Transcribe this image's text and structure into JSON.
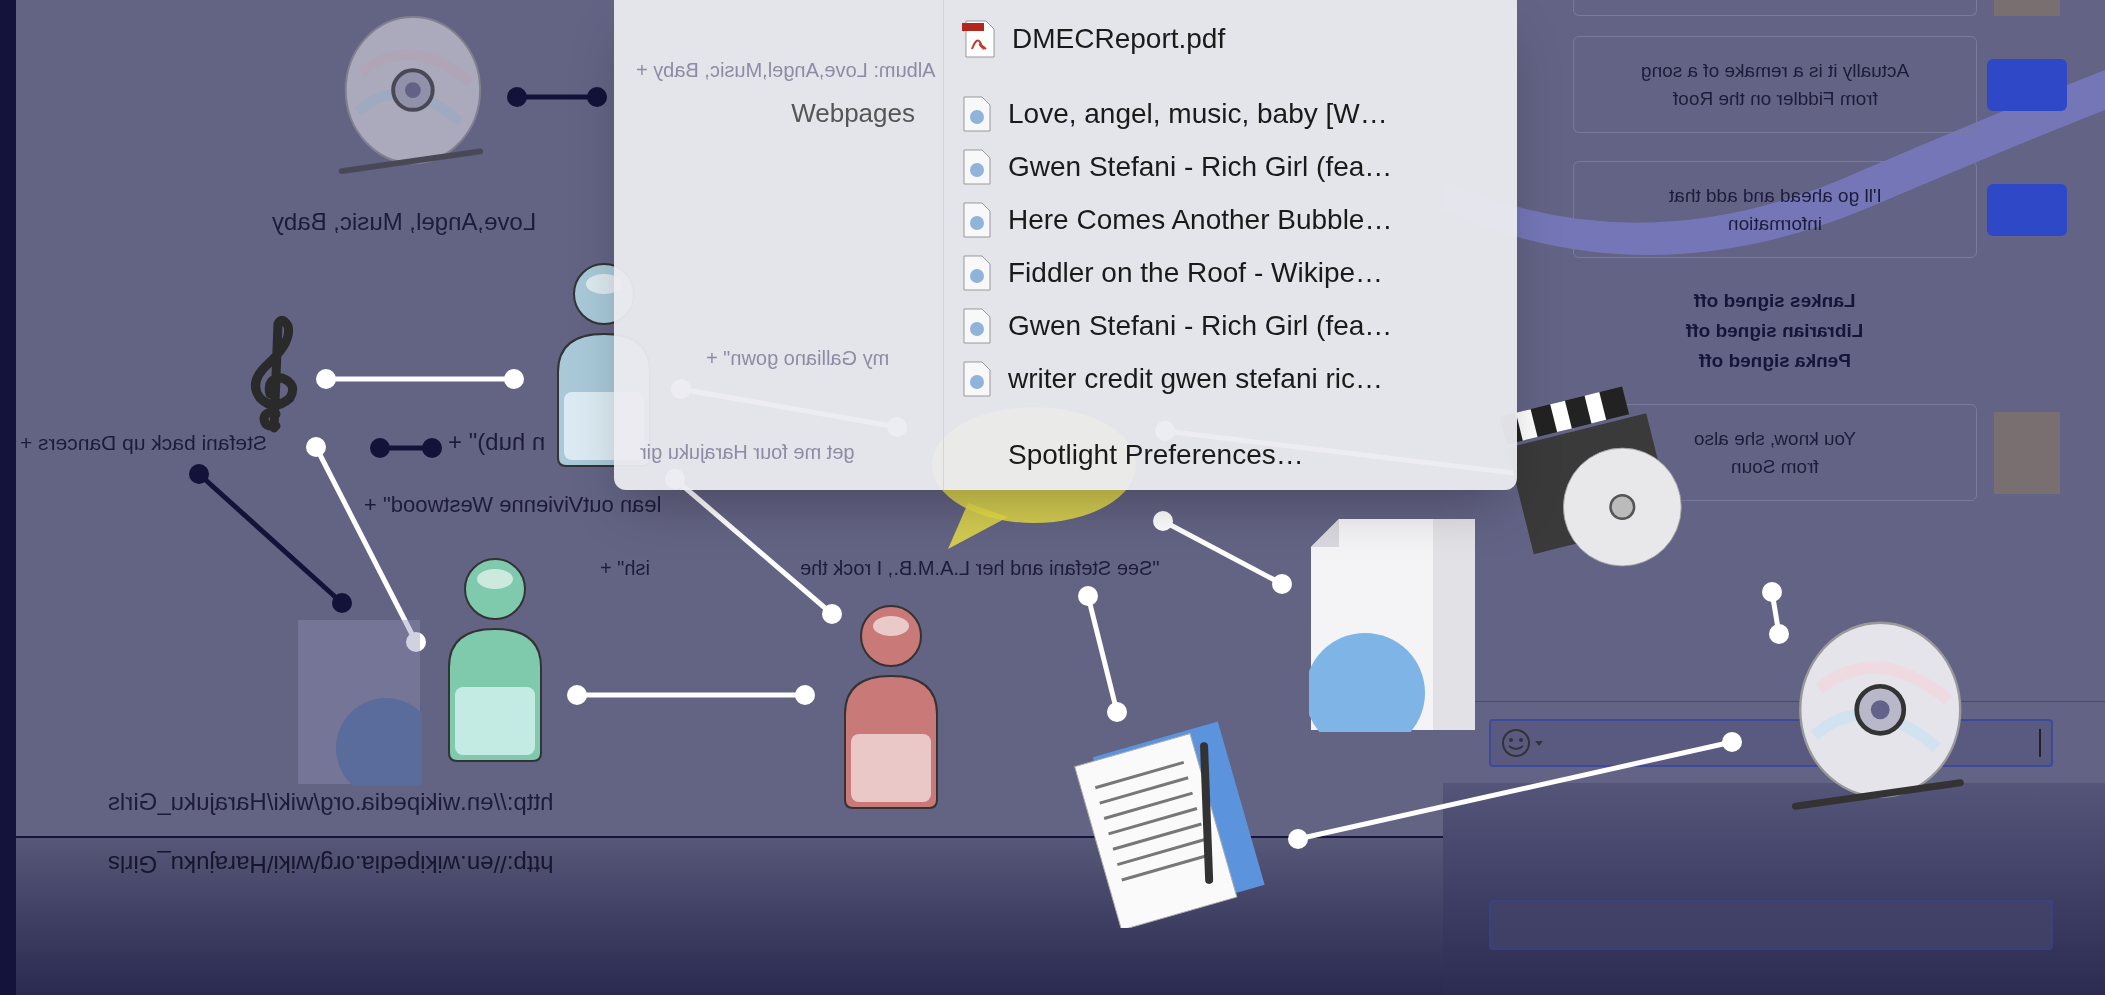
{
  "canvas": {
    "labels": [
      {
        "kind": "ghost",
        "text": "Album: Love,Angel,Music, Baby +"
      },
      {
        "kind": "mirrored",
        "text": "Love,Angel, Music, Baby"
      },
      {
        "kind": "ghost",
        "text": "my Galliano gown\" +"
      },
      {
        "kind": "mirrored",
        "text": "Stefani back up Dancers +"
      },
      {
        "kind": "mirrored",
        "text": "n hub)\" +"
      },
      {
        "kind": "ghost",
        "text": "get me four Harajuku gir"
      },
      {
        "kind": "mirrored",
        "text": "lean outVivienne Westwood\" +"
      },
      {
        "kind": "mirrored",
        "text": "ish\" +"
      },
      {
        "kind": "mirrored",
        "text": "\"See Stefani and her L.A.M.B., I rock the"
      },
      {
        "kind": "mirrored",
        "text": "http://en.wikipedia.org/wiki/Harajuku_Girls"
      },
      {
        "kind": "reflection",
        "text": "http://en.wikipedia.org/wiki/Harajuku_Girls"
      }
    ]
  },
  "spotlight_menu": {
    "documents": [
      {
        "kind": "pdf",
        "text": "DMECReport.pdf"
      }
    ],
    "sections": [
      {
        "label": "Webpages",
        "items": [
          {
            "kind": "webpage",
            "text": "Love, angel, music, baby [W…"
          },
          {
            "kind": "webpage",
            "text": "Gwen Stefani - Rich Girl (fea…"
          },
          {
            "kind": "webpage",
            "text": "Here Comes Another Bubble…"
          },
          {
            "kind": "webpage",
            "text": "Fiddler on the Roof - Wikipe…"
          },
          {
            "kind": "webpage",
            "text": "Gwen Stefani - Rich Girl (fea…"
          },
          {
            "kind": "webpage",
            "text": "writer credit gwen stefani ric…"
          }
        ]
      }
    ],
    "footer": "Spotlight Preferences…"
  },
  "chat": {
    "entries": [
      {
        "kind": "message",
        "avatar": {
          "kind": "logo"
        },
        "lines": [
          "Actually it is a remake of a song",
          "from Fiddler on the Roof"
        ]
      },
      {
        "kind": "message",
        "avatar": {
          "kind": "logo"
        },
        "lines": [
          "I'll go ahead and add that",
          "information"
        ]
      },
      {
        "kind": "status",
        "lines": [
          "Lankes signed off",
          "Librarian signed off",
          "Penka signed off"
        ]
      },
      {
        "kind": "message",
        "avatar": {
          "kind": "photo"
        },
        "lines": [
          "You know, she also",
          "from Soun"
        ]
      }
    ]
  }
}
